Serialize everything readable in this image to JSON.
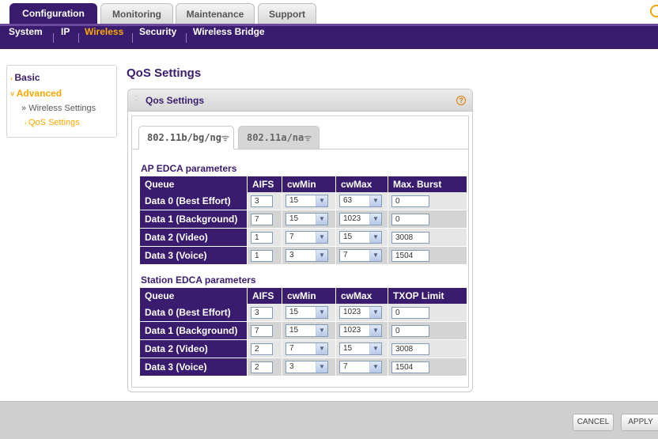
{
  "top_tabs": [
    {
      "label": "Configuration",
      "active": true
    },
    {
      "label": "Monitoring",
      "active": false
    },
    {
      "label": "Maintenance",
      "active": false
    },
    {
      "label": "Support",
      "active": false
    }
  ],
  "sub_nav": [
    {
      "label": "System",
      "active": false
    },
    {
      "label": "IP",
      "active": false
    },
    {
      "label": "Wireless",
      "active": true
    },
    {
      "label": "Security",
      "active": false
    },
    {
      "label": "Wireless Bridge",
      "active": false
    }
  ],
  "left_nav": {
    "basic": "Basic",
    "advanced": "Advanced",
    "wireless_settings": "Wireless Settings",
    "qos_settings": "QoS Settings"
  },
  "page_title": "QoS Settings",
  "panel": {
    "title": "Qos Settings",
    "help": "?",
    "tabs": [
      {
        "label": "802.11b/bg/ng",
        "active": true
      },
      {
        "label": "802.11a/na",
        "active": false
      }
    ]
  },
  "ap": {
    "section_title": "AP EDCA parameters",
    "headers": [
      "Queue",
      "AIFS",
      "cwMin",
      "cwMax",
      "Max. Burst"
    ],
    "rows": [
      {
        "queue": "Data 0 (Best Effort)",
        "aifs": "3",
        "cwmin": "15",
        "cwmax": "63",
        "last": "0"
      },
      {
        "queue": "Data 1 (Background)",
        "aifs": "7",
        "cwmin": "15",
        "cwmax": "1023",
        "last": "0"
      },
      {
        "queue": "Data 2 (Video)",
        "aifs": "1",
        "cwmin": "7",
        "cwmax": "15",
        "last": "3008"
      },
      {
        "queue": "Data 3 (Voice)",
        "aifs": "1",
        "cwmin": "3",
        "cwmax": "7",
        "last": "1504"
      }
    ]
  },
  "station": {
    "section_title": "Station EDCA parameters",
    "headers": [
      "Queue",
      "AIFS",
      "cwMin",
      "cwMax",
      "TXOP Limit"
    ],
    "rows": [
      {
        "queue": "Data 0 (Best Effort)",
        "aifs": "3",
        "cwmin": "15",
        "cwmax": "1023",
        "last": "0"
      },
      {
        "queue": "Data 1 (Background)",
        "aifs": "7",
        "cwmin": "15",
        "cwmax": "1023",
        "last": "0"
      },
      {
        "queue": "Data 2 (Video)",
        "aifs": "2",
        "cwmin": "7",
        "cwmax": "15",
        "last": "3008"
      },
      {
        "queue": "Data 3 (Voice)",
        "aifs": "2",
        "cwmin": "3",
        "cwmax": "7",
        "last": "1504"
      }
    ]
  },
  "footer": {
    "cancel": "CANCEL",
    "apply": "APPLY"
  },
  "colors": {
    "brand_purple": "#3a1c6e",
    "accent_orange": "#f8a800"
  }
}
